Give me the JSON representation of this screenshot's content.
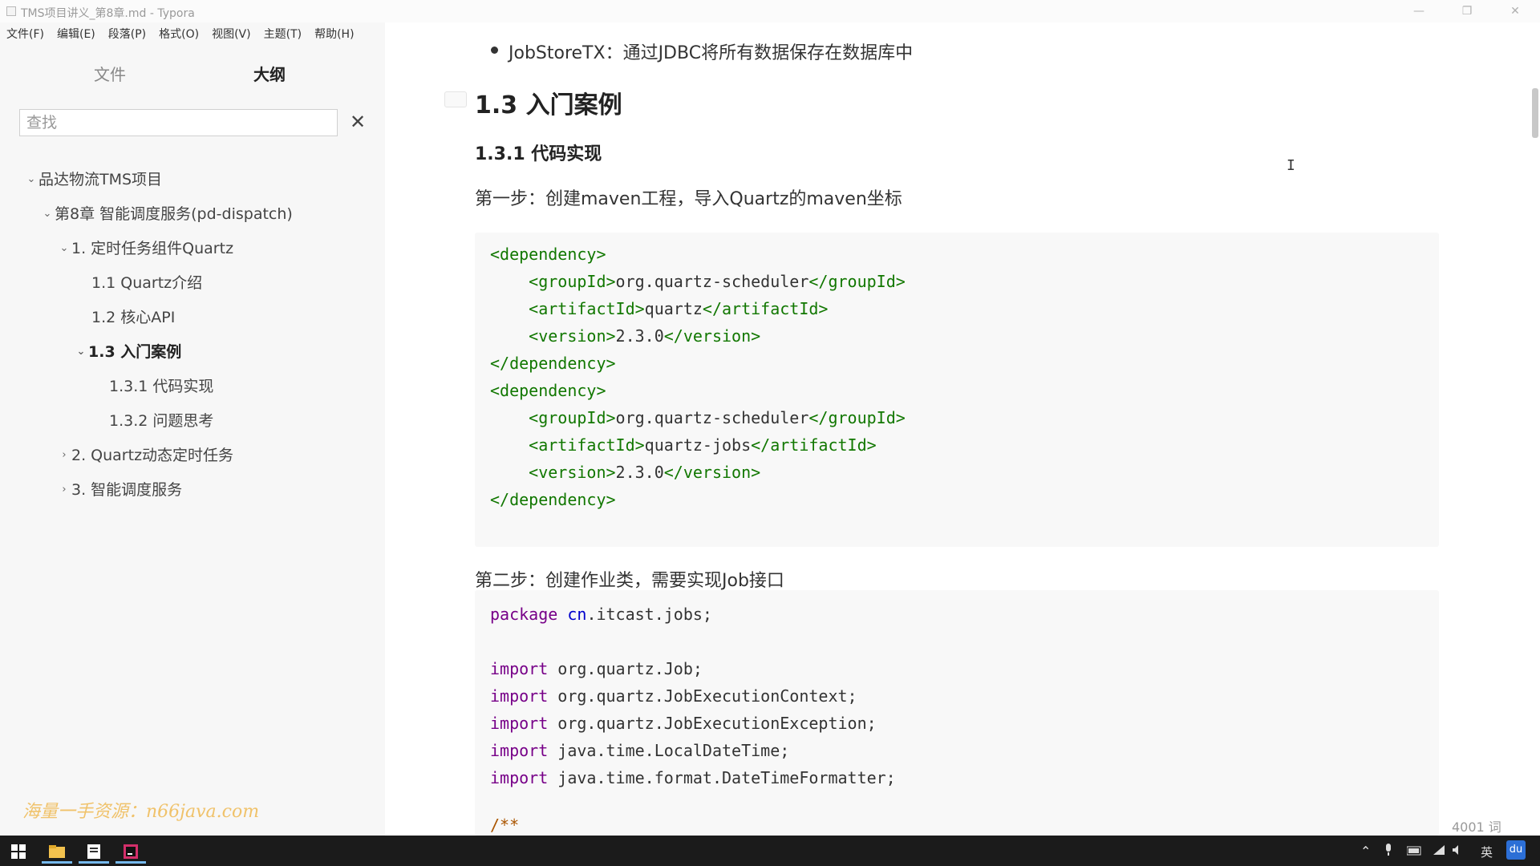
{
  "window": {
    "title": "TMS项目讲义_第8章.md - Typora",
    "controls": [
      "—",
      "❐",
      "✕"
    ]
  },
  "menu": [
    "文件(F)",
    "编辑(E)",
    "段落(P)",
    "格式(O)",
    "视图(V)",
    "主题(T)",
    "帮助(H)"
  ],
  "sidebar": {
    "tabs": {
      "files": "文件",
      "outline": "大纲"
    },
    "search": {
      "placeholder": "查找"
    },
    "outline": [
      {
        "chev": "⌄",
        "label": "品达物流TMS项目"
      },
      {
        "chev": "⌄",
        "label": "第8章 智能调度服务(pd-dispatch)"
      },
      {
        "chev": "⌄",
        "label": "1. 定时任务组件Quartz"
      },
      {
        "chev": "",
        "label": "1.1 Quartz介绍"
      },
      {
        "chev": "",
        "label": "1.2 核心API"
      },
      {
        "chev": "⌄",
        "label": "1.3 入门案例"
      },
      {
        "chev": "",
        "label": "1.3.1 代码实现"
      },
      {
        "chev": "",
        "label": "1.3.2 问题思考"
      },
      {
        "chev": "›",
        "label": "2. Quartz动态定时任务"
      },
      {
        "chev": "›",
        "label": "3. 智能调度服务"
      }
    ],
    "watermark": "海量一手资源：n66java.com",
    "footer": {
      "collapse": "‹",
      "source": "</>"
    }
  },
  "editor": {
    "bullet": "JobStoreTX：通过JDBC将所有数据保存在数据库中",
    "h2": "1.3 入门案例",
    "h3": "1.3.1 代码实现",
    "step1": "第一步：创建maven工程，导入Quartz的maven坐标",
    "step2": "第二步：创建作业类，需要实现Job接口",
    "code1": [
      {
        "o": "<dependency>"
      },
      {
        "indent": "    ",
        "o": "<groupId>",
        "t": "org.quartz-scheduler",
        "c": "</groupId>"
      },
      {
        "indent": "    ",
        "o": "<artifactId>",
        "t": "quartz",
        "c": "</artifactId>"
      },
      {
        "indent": "    ",
        "o": "<version>",
        "t": "2.3.0",
        "c": "</version>"
      },
      {
        "o": "</dependency>"
      },
      {
        "o": "<dependency>"
      },
      {
        "indent": "    ",
        "o": "<groupId>",
        "t": "org.quartz-scheduler",
        "c": "</groupId>"
      },
      {
        "indent": "    ",
        "o": "<artifactId>",
        "t": "quartz-jobs",
        "c": "</artifactId>"
      },
      {
        "indent": "    ",
        "o": "<version>",
        "t": "2.3.0",
        "c": "</version>"
      },
      {
        "o": "</dependency>"
      }
    ],
    "code2": {
      "package_kw": "package",
      "package_cn": "cn",
      "package_rest": ".itcast.jobs;",
      "imports": [
        {
          "kw": "import",
          "rest": " org.quartz.Job;"
        },
        {
          "kw": "import",
          "rest": " org.quartz.JobExecutionContext;"
        },
        {
          "kw": "import",
          "rest": " org.quartz.JobExecutionException;"
        },
        {
          "kw": "import",
          "rest": " java.time.LocalDateTime;"
        },
        {
          "kw": "import",
          "rest": " java.time.format.DateTimeFormatter;"
        }
      ],
      "comment_start": "/**"
    },
    "word_count": "4001 词"
  },
  "taskbar": {
    "tray_lang": "英",
    "tray_baidu": "du"
  }
}
